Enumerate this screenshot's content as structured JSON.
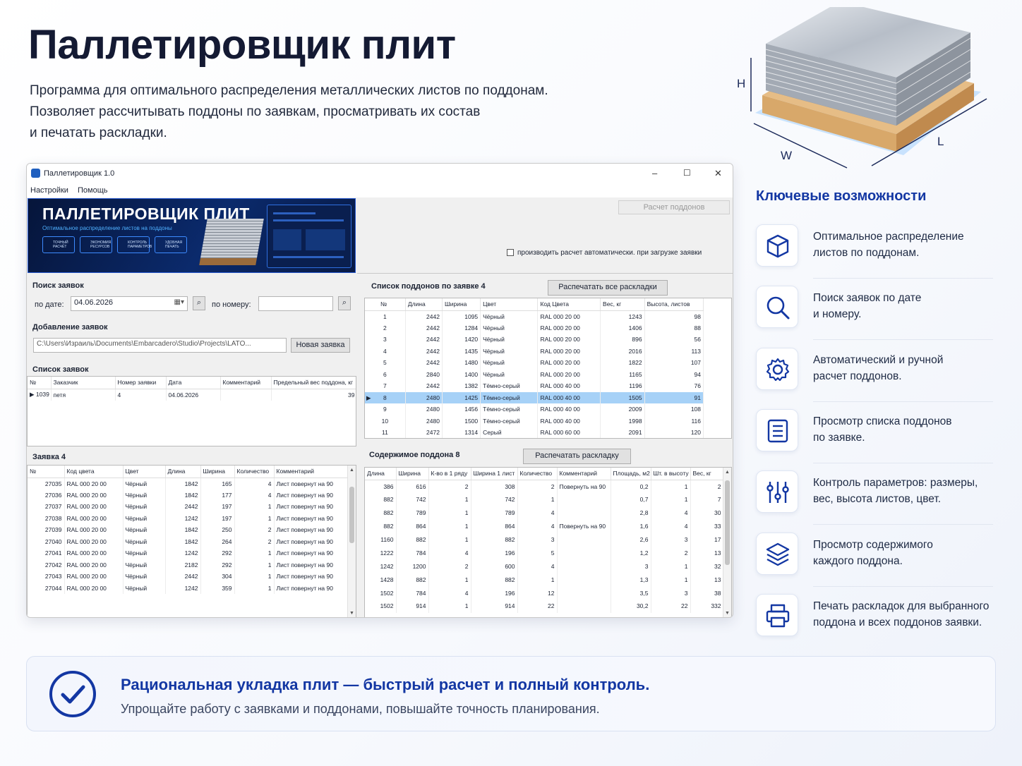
{
  "hero": {
    "title": "Паллетировщик плит",
    "desc_lines": [
      "Программа для оптимального распределения металлических листов по поддонам.",
      "Позволяет рассчитывать поддоны по заявкам, просматривать их состав",
      "и печатать раскладки."
    ],
    "dim_labels": {
      "h": "H",
      "w": "W",
      "l": "L"
    }
  },
  "window": {
    "title": "Паллетировщик 1.0",
    "menu": [
      "Настройки",
      "Помощь"
    ],
    "banner": {
      "title": "ПАЛЛЕТИРОВЩИК ПЛИТ",
      "subtitle": "Оптимальное распределение листов на поддоны",
      "badges": [
        "ТОЧНЫЙ РАСЧЁТ",
        "ЭКОНОМИЯ РЕСУРСОВ",
        "КОНТРОЛЬ ПАРАМЕТРОВ",
        "УДОБНАЯ ПЕЧАТЬ"
      ]
    },
    "calc_button": "Расчет поддонов",
    "auto_checkbox_label": "производить расчет автоматически. при загрузке заявки",
    "search": {
      "heading": "Поиск заявок",
      "date_label": "по дате:",
      "date_value": "04.06.2026",
      "number_label": "по номеру:",
      "number_value": ""
    },
    "add": {
      "heading": "Добавление заявок",
      "path": "C:\\Users\\Израиль\\Documents\\Embarcadero\\Studio\\Projects\\LATO...",
      "new_button": "Новая заявка"
    },
    "orders": {
      "heading": "Список заявок",
      "columns": [
        "№",
        "Заказчик",
        "Номер заявки",
        "Дата",
        "Комментарий",
        "Предельный вес поддона, кг"
      ],
      "rows": [
        [
          "1039",
          "петя",
          "4",
          "04.06.2026",
          "",
          "39"
        ]
      ]
    },
    "order_detail": {
      "heading": "Заявка 4",
      "columns": [
        "№",
        "Код цвета",
        "Цвет",
        "Длина",
        "Ширина",
        "Количество",
        "Комментарий"
      ],
      "rows": [
        [
          "27035",
          "RAL 000 20 00",
          "Чёрный",
          "1842",
          "165",
          "4",
          "Лист повернут на 90"
        ],
        [
          "27036",
          "RAL 000 20 00",
          "Чёрный",
          "1842",
          "177",
          "4",
          "Лист повернут на 90"
        ],
        [
          "27037",
          "RAL 000 20 00",
          "Чёрный",
          "2442",
          "197",
          "1",
          "Лист повернут на 90"
        ],
        [
          "27038",
          "RAL 000 20 00",
          "Чёрный",
          "1242",
          "197",
          "1",
          "Лист повернут на 90"
        ],
        [
          "27039",
          "RAL 000 20 00",
          "Чёрный",
          "1842",
          "250",
          "2",
          "Лист повернут на 90"
        ],
        [
          "27040",
          "RAL 000 20 00",
          "Чёрный",
          "1842",
          "264",
          "2",
          "Лист повернут на 90"
        ],
        [
          "27041",
          "RAL 000 20 00",
          "Чёрный",
          "1242",
          "292",
          "1",
          "Лист повернут на 90"
        ],
        [
          "27042",
          "RAL 000 20 00",
          "Чёрный",
          "2182",
          "292",
          "1",
          "Лист повернут на 90"
        ],
        [
          "27043",
          "RAL 000 20 00",
          "Чёрный",
          "2442",
          "304",
          "1",
          "Лист повернут на 90"
        ],
        [
          "27044",
          "RAL 000 20 00",
          "Чёрный",
          "1242",
          "359",
          "1",
          "Лист повернут на 90"
        ]
      ]
    },
    "pallets": {
      "heading": "Список поддонов по заявке 4",
      "print_all_button": "Распечатать все раскладки",
      "columns": [
        "№",
        "Длина",
        "Ширина",
        "Цвет",
        "Код Цвета",
        "Вес, кг",
        "Высота, листов"
      ],
      "selected_index": 7,
      "rows": [
        [
          "1",
          "2442",
          "1095",
          "Чёрный",
          "RAL 000 20 00",
          "1243",
          "98"
        ],
        [
          "2",
          "2442",
          "1284",
          "Чёрный",
          "RAL 000 20 00",
          "1406",
          "88"
        ],
        [
          "3",
          "2442",
          "1420",
          "Чёрный",
          "RAL 000 20 00",
          "896",
          "56"
        ],
        [
          "4",
          "2442",
          "1435",
          "Чёрный",
          "RAL 000 20 00",
          "2016",
          "113"
        ],
        [
          "5",
          "2442",
          "1480",
          "Чёрный",
          "RAL 000 20 00",
          "1822",
          "107"
        ],
        [
          "6",
          "2840",
          "1400",
          "Чёрный",
          "RAL 000 20 00",
          "1165",
          "94"
        ],
        [
          "7",
          "2442",
          "1382",
          "Тёмно-серый",
          "RAL 000 40 00",
          "1196",
          "76"
        ],
        [
          "8",
          "2480",
          "1425",
          "Тёмно-серый",
          "RAL 000 40 00",
          "1505",
          "91"
        ],
        [
          "9",
          "2480",
          "1456",
          "Тёмно-серый",
          "RAL 000 40 00",
          "2009",
          "108"
        ],
        [
          "10",
          "2480",
          "1500",
          "Тёмно-серый",
          "RAL 000 40 00",
          "1998",
          "116"
        ],
        [
          "11",
          "2472",
          "1314",
          "Серый",
          "RAL 000 60 00",
          "2091",
          "120"
        ]
      ]
    },
    "pallet_content": {
      "heading": "Содержимое поддона 8",
      "print_button": "Распечатать раскладку",
      "columns": [
        "Длина",
        "Ширина",
        "К-во в 1 ряду",
        "Ширина 1 лист",
        "Количество",
        "Комментарий",
        "Площадь, м2",
        "Шт. в высоту",
        "Вес, кг"
      ],
      "rows": [
        [
          "386",
          "616",
          "2",
          "308",
          "2",
          "Повернуть на 90",
          "0,2",
          "1",
          "2"
        ],
        [
          "882",
          "742",
          "1",
          "742",
          "1",
          "",
          "0,7",
          "1",
          "7"
        ],
        [
          "882",
          "789",
          "1",
          "789",
          "4",
          "",
          "2,8",
          "4",
          "30"
        ],
        [
          "882",
          "864",
          "1",
          "864",
          "4",
          "Повернуть на 90",
          "1,6",
          "4",
          "33"
        ],
        [
          "1160",
          "882",
          "1",
          "882",
          "3",
          "",
          "2,6",
          "3",
          "17"
        ],
        [
          "1222",
          "784",
          "4",
          "196",
          "5",
          "",
          "1,2",
          "2",
          "13"
        ],
        [
          "1242",
          "1200",
          "2",
          "600",
          "4",
          "",
          "3",
          "1",
          "32"
        ],
        [
          "1428",
          "882",
          "1",
          "882",
          "1",
          "",
          "1,3",
          "1",
          "13"
        ],
        [
          "1502",
          "784",
          "4",
          "196",
          "12",
          "",
          "3,5",
          "3",
          "38"
        ],
        [
          "1502",
          "914",
          "1",
          "914",
          "22",
          "",
          "30,2",
          "22",
          "332"
        ]
      ]
    }
  },
  "features": {
    "heading": "Ключевые возможности",
    "items": [
      {
        "icon": "box-icon",
        "lines": [
          "Оптимальное распределение",
          "листов по поддонам."
        ]
      },
      {
        "icon": "search-icon",
        "lines": [
          "Поиск заявок по дате",
          "и номеру."
        ]
      },
      {
        "icon": "gear-icon",
        "lines": [
          "Автоматический и ручной",
          "расчет поддонов."
        ]
      },
      {
        "icon": "list-icon",
        "lines": [
          "Просмотр списка поддонов",
          "по заявке."
        ]
      },
      {
        "icon": "sliders-icon",
        "lines": [
          "Контроль параметров: размеры,",
          "вес, высота листов, цвет."
        ]
      },
      {
        "icon": "layers-icon",
        "lines": [
          "Просмотр содержимого",
          "каждого поддона."
        ]
      },
      {
        "icon": "printer-icon",
        "lines": [
          "Печать раскладок для выбранного",
          "поддона и всех поддонов заявки."
        ]
      }
    ]
  },
  "footer": {
    "title": "Рациональная укладка плит — быстрый расчет и полный контроль.",
    "subtitle": "Упрощайте работу с заявками и поддонами, повышайте точность планирования."
  },
  "colors": {
    "accent": "#1337a3",
    "selection": "#a6d1f7",
    "banner_bg": "#0b2a6c"
  }
}
